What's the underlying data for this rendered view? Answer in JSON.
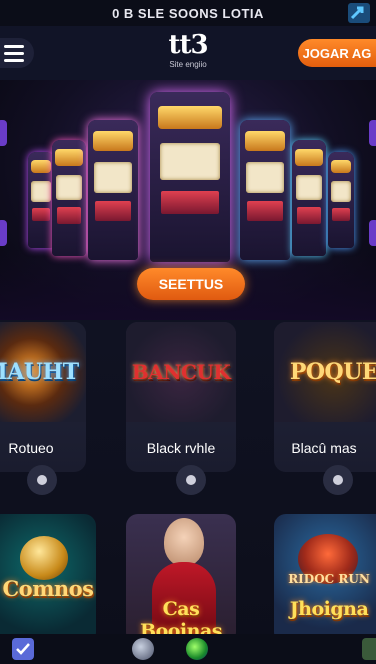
{
  "topbar": {
    "text": "0 B SLE SOONS LOTIA",
    "icon": "share-arrow-icon"
  },
  "header": {
    "menu_icon": "hamburger-icon",
    "logo": "tt3",
    "logo_sub": "Sit⁠e engiio",
    "cta_label": "JOGAR AG"
  },
  "hero": {
    "button_label": "SEETTUS"
  },
  "games_row1": [
    {
      "art": "MAUHT",
      "label": "Rotueo"
    },
    {
      "art": "BANCUK",
      "label": "Black rvhle"
    },
    {
      "art": "POQUE",
      "label": "Blacû mas"
    }
  ],
  "games_row2": [
    {
      "art": "Comnos"
    },
    {
      "art": "Cas Booinas"
    },
    {
      "art": "Jhoigna",
      "art_top": "RIDOC RUN"
    }
  ],
  "bottombar": {
    "icons": [
      "checkbox-icon",
      "globe-icon",
      "green-orb-icon",
      "grid-icon"
    ]
  },
  "colors": {
    "accent": "#ff7a1e",
    "background": "#0d0f1c",
    "card": "#1f2236"
  }
}
